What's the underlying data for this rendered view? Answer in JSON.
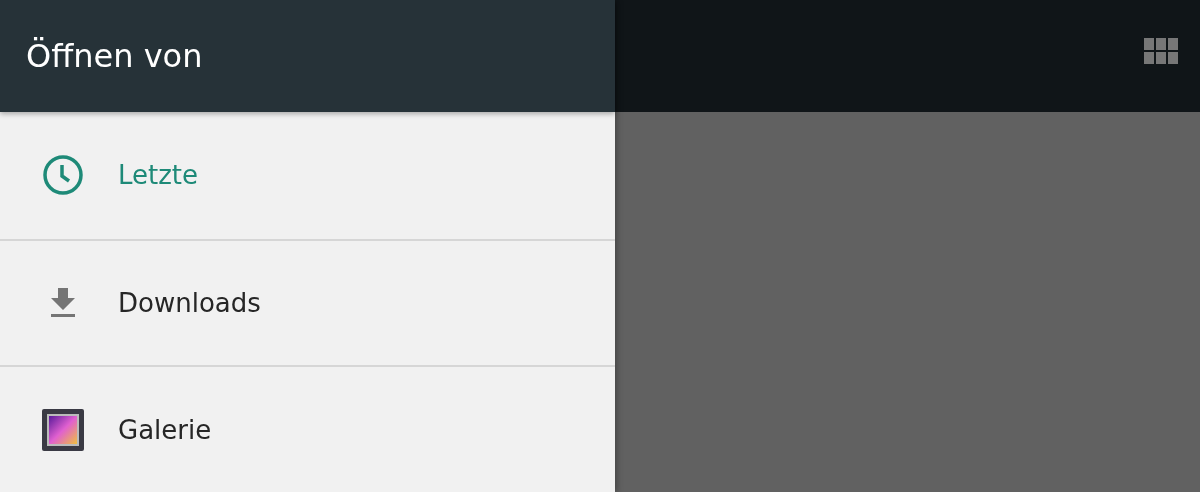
{
  "drawer": {
    "title": "Öffnen von",
    "items": [
      {
        "label": "Letzte",
        "kind": "recent",
        "selected": true
      },
      {
        "label": "Downloads",
        "kind": "download",
        "selected": false
      },
      {
        "label": "Galerie",
        "kind": "gallery",
        "selected": false
      }
    ]
  }
}
